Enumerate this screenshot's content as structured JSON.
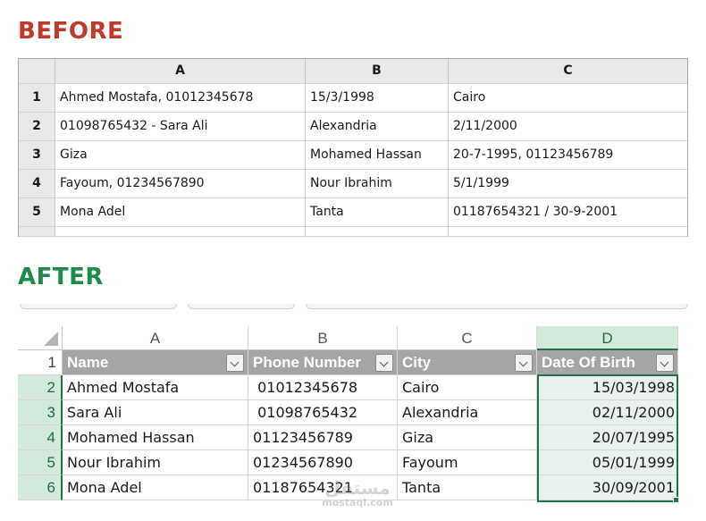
{
  "before": {
    "title": "BEFORE",
    "columns": [
      "A",
      "B",
      "C"
    ],
    "rows": [
      {
        "num": "1",
        "cells": [
          "Ahmed Mostafa, 01012345678",
          "15/3/1998",
          "Cairo"
        ]
      },
      {
        "num": "2",
        "cells": [
          "01098765432 - Sara Ali",
          "Alexandria",
          "2/11/2000"
        ]
      },
      {
        "num": "3",
        "cells": [
          "Giza",
          "Mohamed Hassan",
          "20-7-1995, 01123456789"
        ]
      },
      {
        "num": "4",
        "cells": [
          "Fayoum, 01234567890",
          "Nour Ibrahim",
          "5/1/1999"
        ]
      },
      {
        "num": "5",
        "cells": [
          "Mona Adel",
          "Tanta",
          "01187654321 / 30-9-2001"
        ]
      }
    ]
  },
  "after": {
    "title": "AFTER",
    "columns": [
      "A",
      "B",
      "C",
      "D"
    ],
    "header_row_num": "1",
    "headers": [
      "Name",
      "Phone Number",
      "City",
      "Date Of Birth"
    ],
    "rows": [
      {
        "num": "2",
        "cells": [
          "Ahmed Mostafa",
          " 01012345678",
          "Cairo",
          "15/03/1998"
        ]
      },
      {
        "num": "3",
        "cells": [
          "Sara Ali",
          " 01098765432",
          "Alexandria",
          "02/11/2000"
        ]
      },
      {
        "num": "4",
        "cells": [
          "Mohamed Hassan",
          "01123456789",
          "Giza",
          "20/07/1995"
        ]
      },
      {
        "num": "5",
        "cells": [
          "Nour Ibrahim",
          "01234567890",
          "Fayoum",
          "05/01/1999"
        ]
      },
      {
        "num": "6",
        "cells": [
          "Mona Adel",
          "01187654321",
          "Tanta",
          "30/09/2001"
        ]
      }
    ],
    "selected_column": "D",
    "filter_icon": "filter-dropdown-icon",
    "accent_color": "#217346"
  },
  "watermark": {
    "line1": "مستقل",
    "line2": "mostaql.com"
  }
}
